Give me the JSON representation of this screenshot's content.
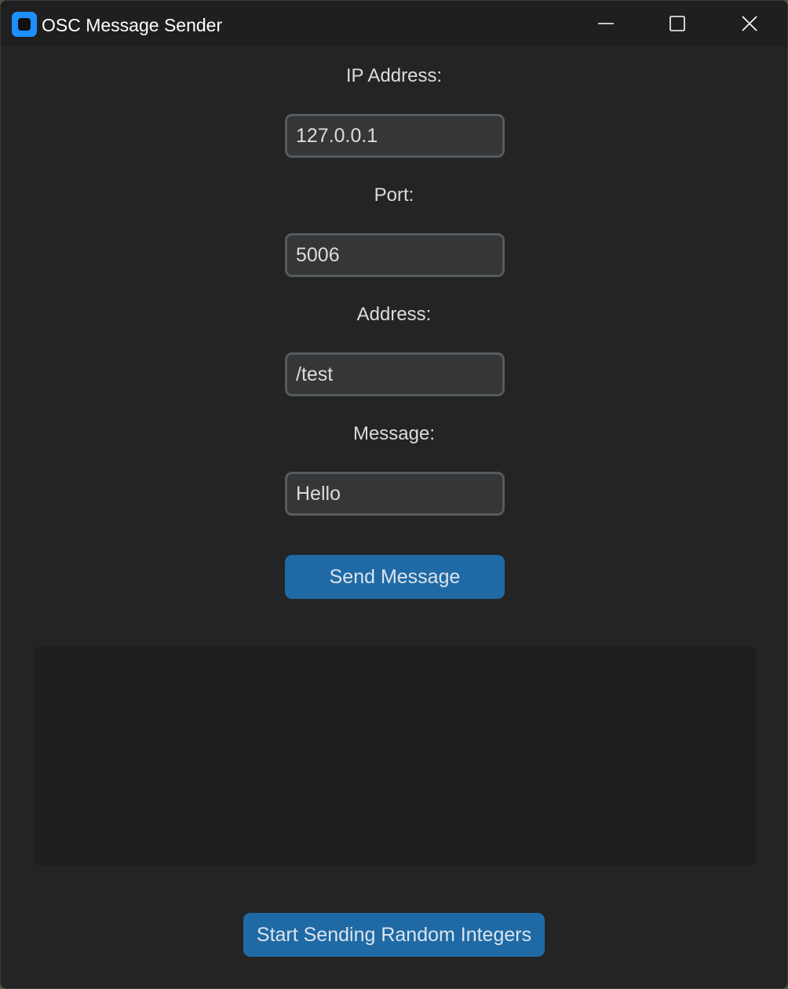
{
  "window": {
    "title": "OSC Message Sender"
  },
  "fields": {
    "ip": {
      "label": "IP Address:",
      "value": "127.0.0.1"
    },
    "port": {
      "label": "Port:",
      "value": "5006"
    },
    "address": {
      "label": "Address:",
      "value": "/test"
    },
    "message": {
      "label": "Message:",
      "value": "Hello"
    }
  },
  "buttons": {
    "send": "Send Message",
    "random": "Start Sending Random Integers"
  },
  "log": {
    "text": ""
  },
  "colors": {
    "accent": "#1f6aa5",
    "app_icon": "#1e8fff",
    "background": "#242424",
    "titlebar": "#1f1f1f"
  },
  "icons": {
    "app": "app-icon",
    "minimize": "minimize-icon",
    "maximize": "maximize-icon",
    "close": "close-icon"
  }
}
